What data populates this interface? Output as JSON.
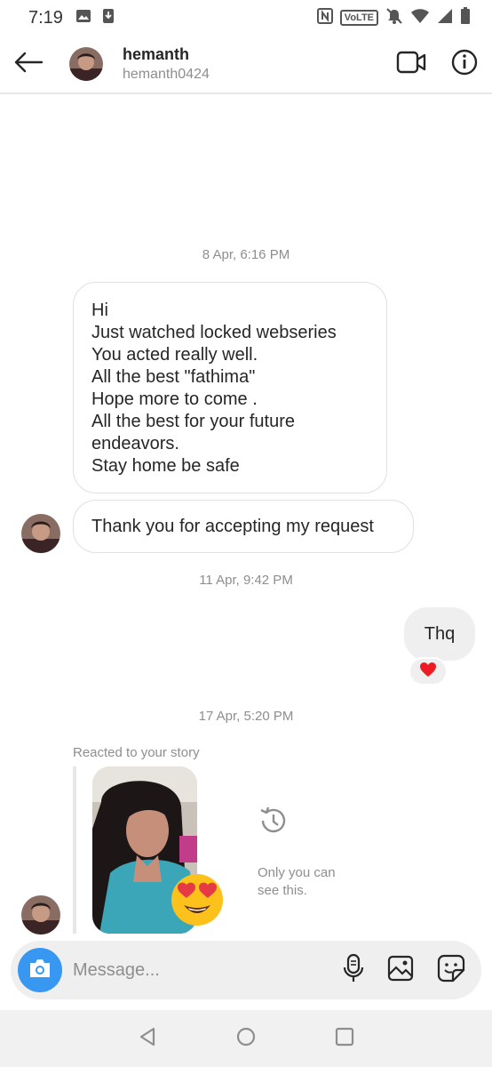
{
  "status_bar": {
    "time": "7:19",
    "network_badge": "VoLTE",
    "icons": [
      "gallery-icon",
      "download-icon",
      "nfc-icon",
      "volte-icon",
      "mute-icon",
      "wifi-icon",
      "signal-icon",
      "battery-icon"
    ]
  },
  "header": {
    "display_name": "hemanth",
    "username": "hemanth0424",
    "icons": [
      "back-arrow-icon",
      "video-call-icon",
      "info-icon"
    ]
  },
  "chat": {
    "timestamp_1": "8 Apr, 6:16 PM",
    "message_1_lines": [
      "Hi",
      "Just watched locked webseries",
      "You acted really well.",
      "All the best \"fathima\"",
      "Hope more to come .",
      "All the best for your future",
      "endeavors.",
      "Stay home be safe"
    ],
    "message_2": "Thank you for accepting my request",
    "timestamp_2": "11 Apr, 9:42 PM",
    "own_message": "Thq",
    "reaction": "heart",
    "timestamp_3": "17 Apr, 5:20 PM",
    "story_caption": "Reacted to your story",
    "story_reaction": "heart-eyes",
    "private_note_line_1": "Only you can",
    "private_note_line_2": "see this."
  },
  "composer": {
    "placeholder": "Message...",
    "icons": [
      "camera-icon",
      "microphone-icon",
      "gallery-icon",
      "sticker-icon"
    ]
  },
  "nav_bar": {
    "icons": [
      "back-nav-icon",
      "home-nav-icon",
      "recents-nav-icon"
    ]
  },
  "colors": {
    "accent_blue": "#3897f0",
    "heart_red": "#ed4956",
    "bubble_border": "#e0e0e0",
    "own_bubble": "#efefef",
    "muted_text": "#8e8e8e"
  }
}
